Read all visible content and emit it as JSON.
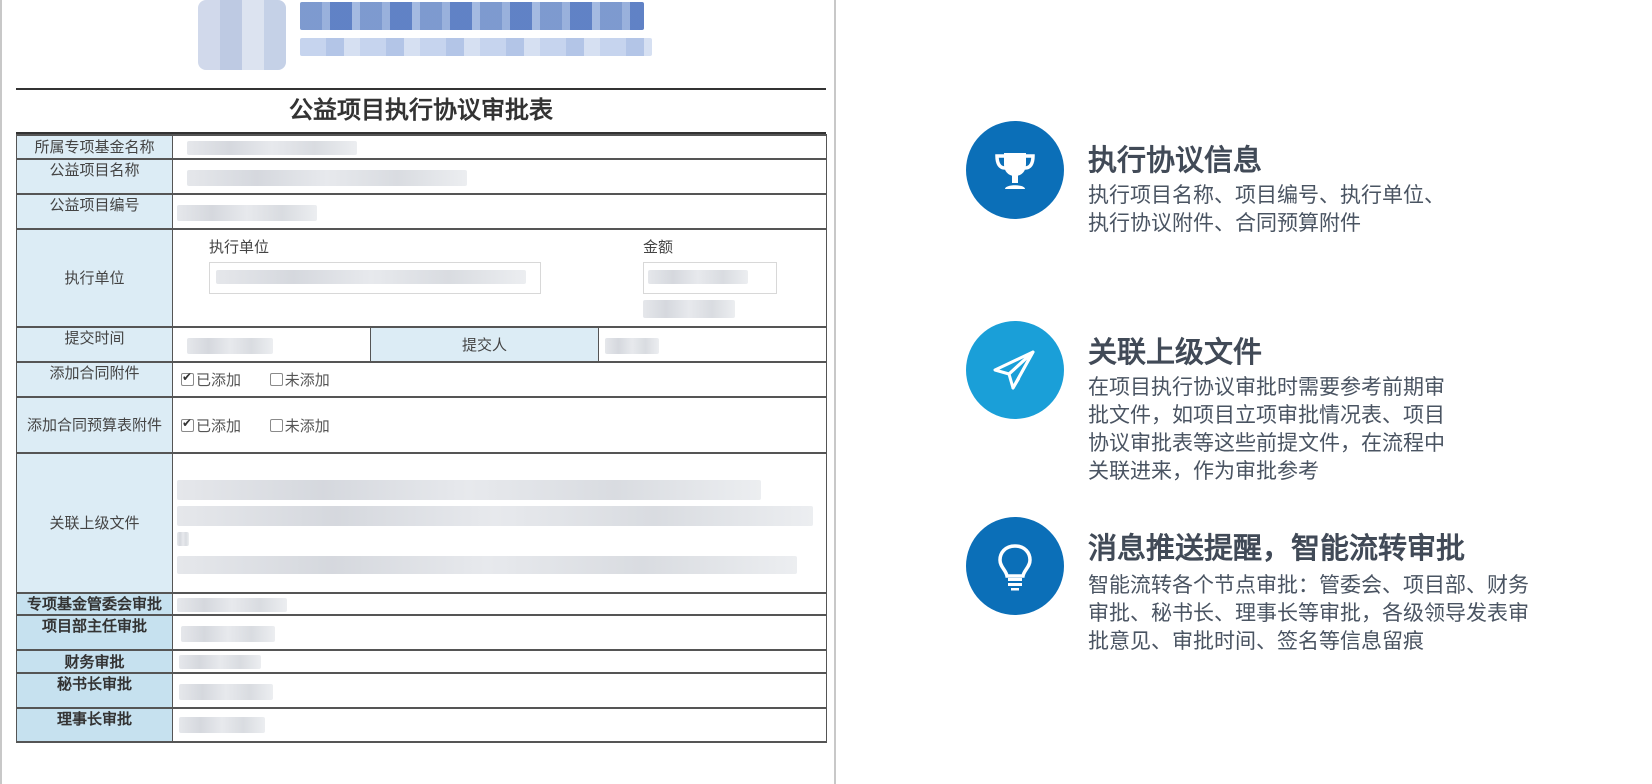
{
  "form": {
    "title": "公益项目执行协议审批表",
    "rows": {
      "fund_name": "所属专项基金名称",
      "project_name": "公益项目名称",
      "project_no": "公益项目编号",
      "exec_unit": "执行单位",
      "exec_unit_sub": "执行单位",
      "amount": "金额",
      "submit_time": "提交时间",
      "submitter": "提交人",
      "contract_attach": "添加合同附件",
      "budget_attach": "添加合同预算表附件",
      "related_docs": "关联上级文件",
      "fund_committee": "专项基金管委会审批",
      "dept_director": "项目部主任审批",
      "finance": "财务审批",
      "secretary_general": "秘书长审批",
      "chairman": "理事长审批"
    },
    "checkbox": {
      "added": "已添加",
      "not_added": "未添加"
    },
    "contract_attach_added": true,
    "budget_attach_added": true
  },
  "features": [
    {
      "icon": "trophy-icon",
      "color": "#0b6fb8",
      "title": "执行协议信息",
      "lines": [
        "执行项目名称、项目编号、执行单位、",
        "执行协议附件、合同预算附件"
      ]
    },
    {
      "icon": "paper-plane-icon",
      "color": "#1a9fd8",
      "title": "关联上级文件",
      "lines": [
        "在项目执行协议审批时需要参考前期审",
        "批文件，如项目立项审批情况表、项目",
        "协议审批表等这些前提文件，在流程中",
        "关联进来，作为审批参考"
      ]
    },
    {
      "icon": "lightbulb-icon",
      "color": "#0b6fb8",
      "title": "消息推送提醒，智能流转审批",
      "lines": [
        "智能流转各个节点审批：管委会、项目部、财务",
        "审批、秘书长、理事长等审批，各级领导发表审",
        "批意见、审批时间、签名等信息留痕"
      ]
    }
  ]
}
